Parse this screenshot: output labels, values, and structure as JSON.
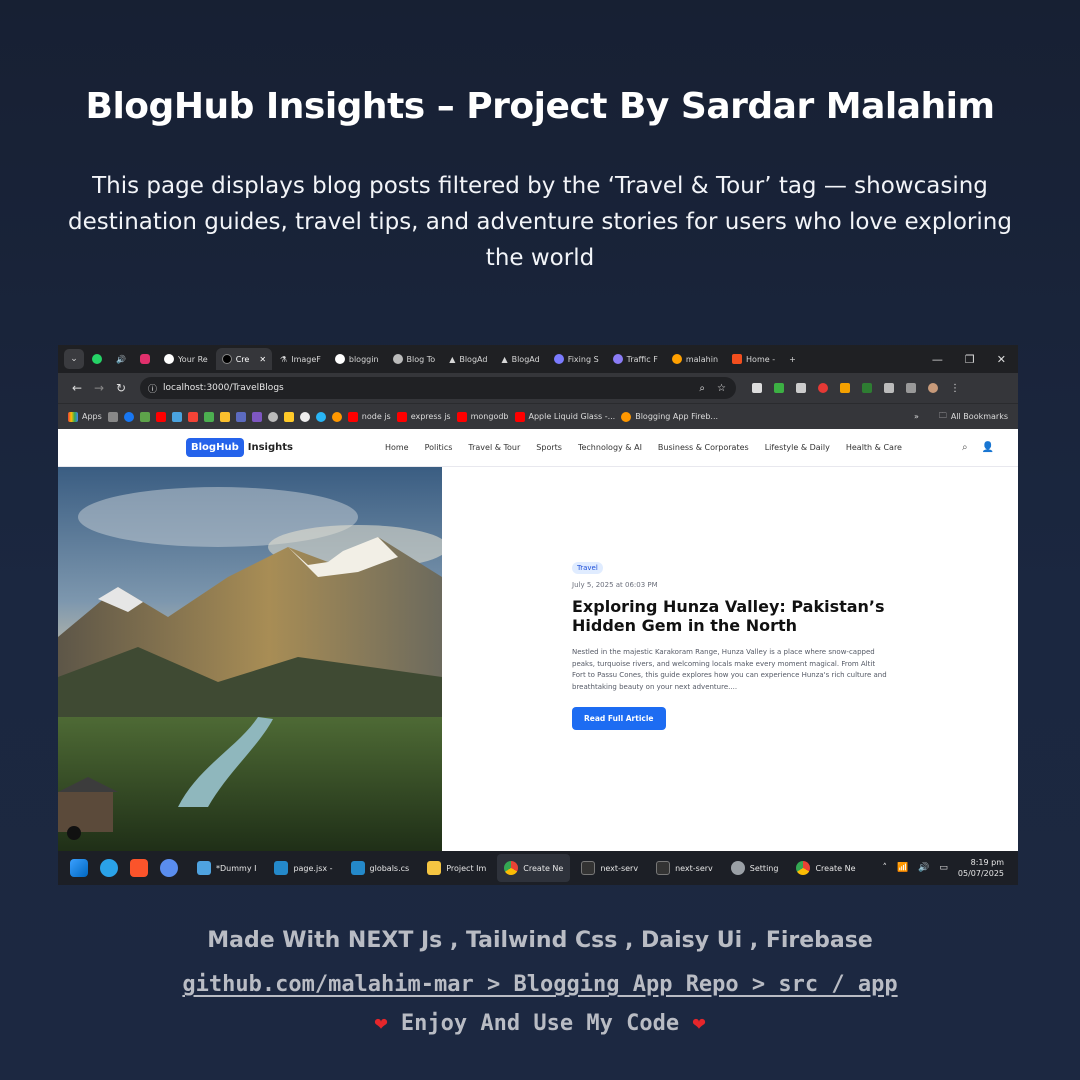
{
  "headline": "BlogHub Insights – Project By Sardar Malahim",
  "subtitle": "This page displays blog posts filtered by the ‘Travel & Tour’ tag — showcasing destination guides, travel tips, and adventure stories for users who love exploring the world",
  "browser": {
    "tabs": [
      {
        "label": "Your Re",
        "icon": "github-icon"
      },
      {
        "label": "Cre",
        "icon": "vercel-icon",
        "active": true
      },
      {
        "label": "ImageF",
        "icon": "flask-icon"
      },
      {
        "label": "bloggin",
        "icon": "github-icon"
      },
      {
        "label": "Blog To",
        "icon": "openai-icon"
      },
      {
        "label": "BlogAd",
        "icon": "vercel-icon"
      },
      {
        "label": "BlogAd",
        "icon": "vercel-icon"
      },
      {
        "label": "Fixing S",
        "icon": "shape-icon"
      },
      {
        "label": "Traffic F",
        "icon": "bot-icon"
      },
      {
        "label": "malahin",
        "icon": "firebase-icon"
      },
      {
        "label": "Home -",
        "icon": "figma-icon"
      }
    ],
    "url": "localhost:3000/TravelBlogs",
    "bookmarks": [
      "Apps",
      "node js",
      "express js",
      "mongodb",
      "Apple Liquid Glass -...",
      "Blogging App Fireb...",
      "All Bookmarks"
    ],
    "colors": {
      "tabbar": "#1f2023",
      "toolbar": "#35363a"
    }
  },
  "site": {
    "logo_pill": "BlogHub",
    "logo_text": "Insights",
    "nav": [
      "Home",
      "Politics",
      "Travel & Tour",
      "Sports",
      "Technology & AI",
      "Business & Corporates",
      "Lifestyle & Daily",
      "Health & Care"
    ],
    "post": {
      "tag": "Travel",
      "date": "July 5, 2025 at 06:03 PM",
      "title": "Exploring Hunza Valley: Pakistan’s Hidden Gem in the North",
      "excerpt": "Nestled in the majestic Karakoram Range, Hunza Valley is a place where snow-capped peaks, turquoise rivers, and welcoming locals make every moment magical. From Altit Fort to Passu Cones, this guide explores how you can experience Hunza's rich culture and breathtaking beauty on your next adventure....",
      "cta": "Read Full Article"
    },
    "accent": "#1d6cf2"
  },
  "taskbar": {
    "apps": [
      {
        "label": "*Dummy I",
        "icon": "notepad-icon"
      },
      {
        "label": "page.jsx -",
        "icon": "vscode-icon"
      },
      {
        "label": "globals.cs",
        "icon": "vscode-icon"
      },
      {
        "label": "Project Im",
        "icon": "folder-icon"
      },
      {
        "label": "Create Ne",
        "icon": "chrome-icon",
        "active": true
      },
      {
        "label": "next-serv",
        "icon": "terminal-icon"
      },
      {
        "label": "next-serv",
        "icon": "terminal-icon"
      },
      {
        "label": "Setting",
        "icon": "settings-icon"
      },
      {
        "label": "Create Ne",
        "icon": "chrome-icon"
      }
    ],
    "time": "8:19 pm",
    "date": "05/07/2025"
  },
  "footer": {
    "stack": "Made With NEXT Js , Tailwind Css  , Daisy Ui , Firebase",
    "repo_path": "github.com/malahim-mar > Blogging App Repo > src / app",
    "closing": "Enjoy And Use My Code"
  }
}
